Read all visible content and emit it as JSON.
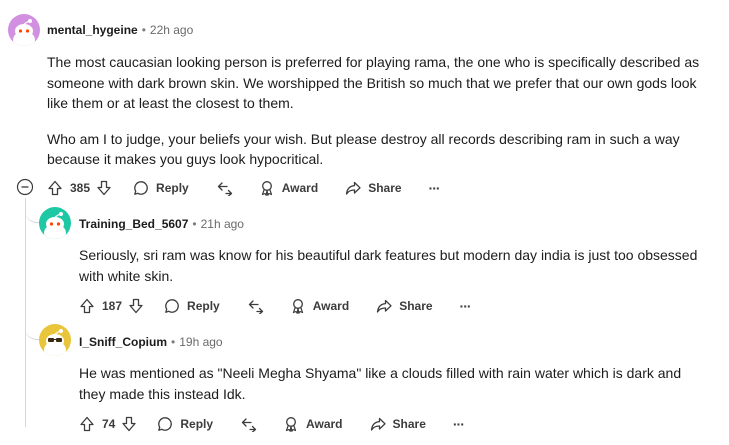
{
  "comments": [
    {
      "username": "mental_hygeine",
      "time": "22h ago",
      "avatar_color": "#d190e0",
      "paragraphs": [
        "The most caucasian looking person is preferred for playing rama, the one who is specifically described as someone with dark brown skin. We worshipped the British so much that we prefer that our own gods look like them or at least the closest to them.",
        "Who am I to judge, your beliefs your wish. But please destroy all records describing ram in such a way because it makes you guys look hypocritical."
      ],
      "votes": "385",
      "reply_label": "Reply",
      "award_label": "Award",
      "share_label": "Share",
      "more_label": "···"
    },
    {
      "username": "Training_Bed_5607",
      "time": "21h ago",
      "avatar_color": "#1fc8a4",
      "paragraphs": [
        "Seriously, sri ram was know for his beautiful dark features but modern day india is just too obsessed with white skin."
      ],
      "votes": "187",
      "reply_label": "Reply",
      "award_label": "Award",
      "share_label": "Share",
      "more_label": "···"
    },
    {
      "username": "I_Sniff_Copium",
      "time": "19h ago",
      "avatar_color": "#e8c53a",
      "paragraphs": [
        "He was mentioned as \"Neeli Megha Shyama\" like a clouds filled with rain water which is dark and they made this instead Idk."
      ],
      "votes": "74",
      "reply_label": "Reply",
      "award_label": "Award",
      "share_label": "Share",
      "more_label": "···"
    }
  ],
  "separator": "•",
  "icons": {
    "upvote": "upvote-arrow-icon",
    "downvote": "downvote-arrow-icon",
    "reply": "speech-bubble-icon",
    "quote": "quote-reply-icon",
    "award": "award-ribbon-icon",
    "share": "share-arrow-icon",
    "collapse": "collapse-minus-icon",
    "avatar": "snoo-avatar-icon"
  }
}
